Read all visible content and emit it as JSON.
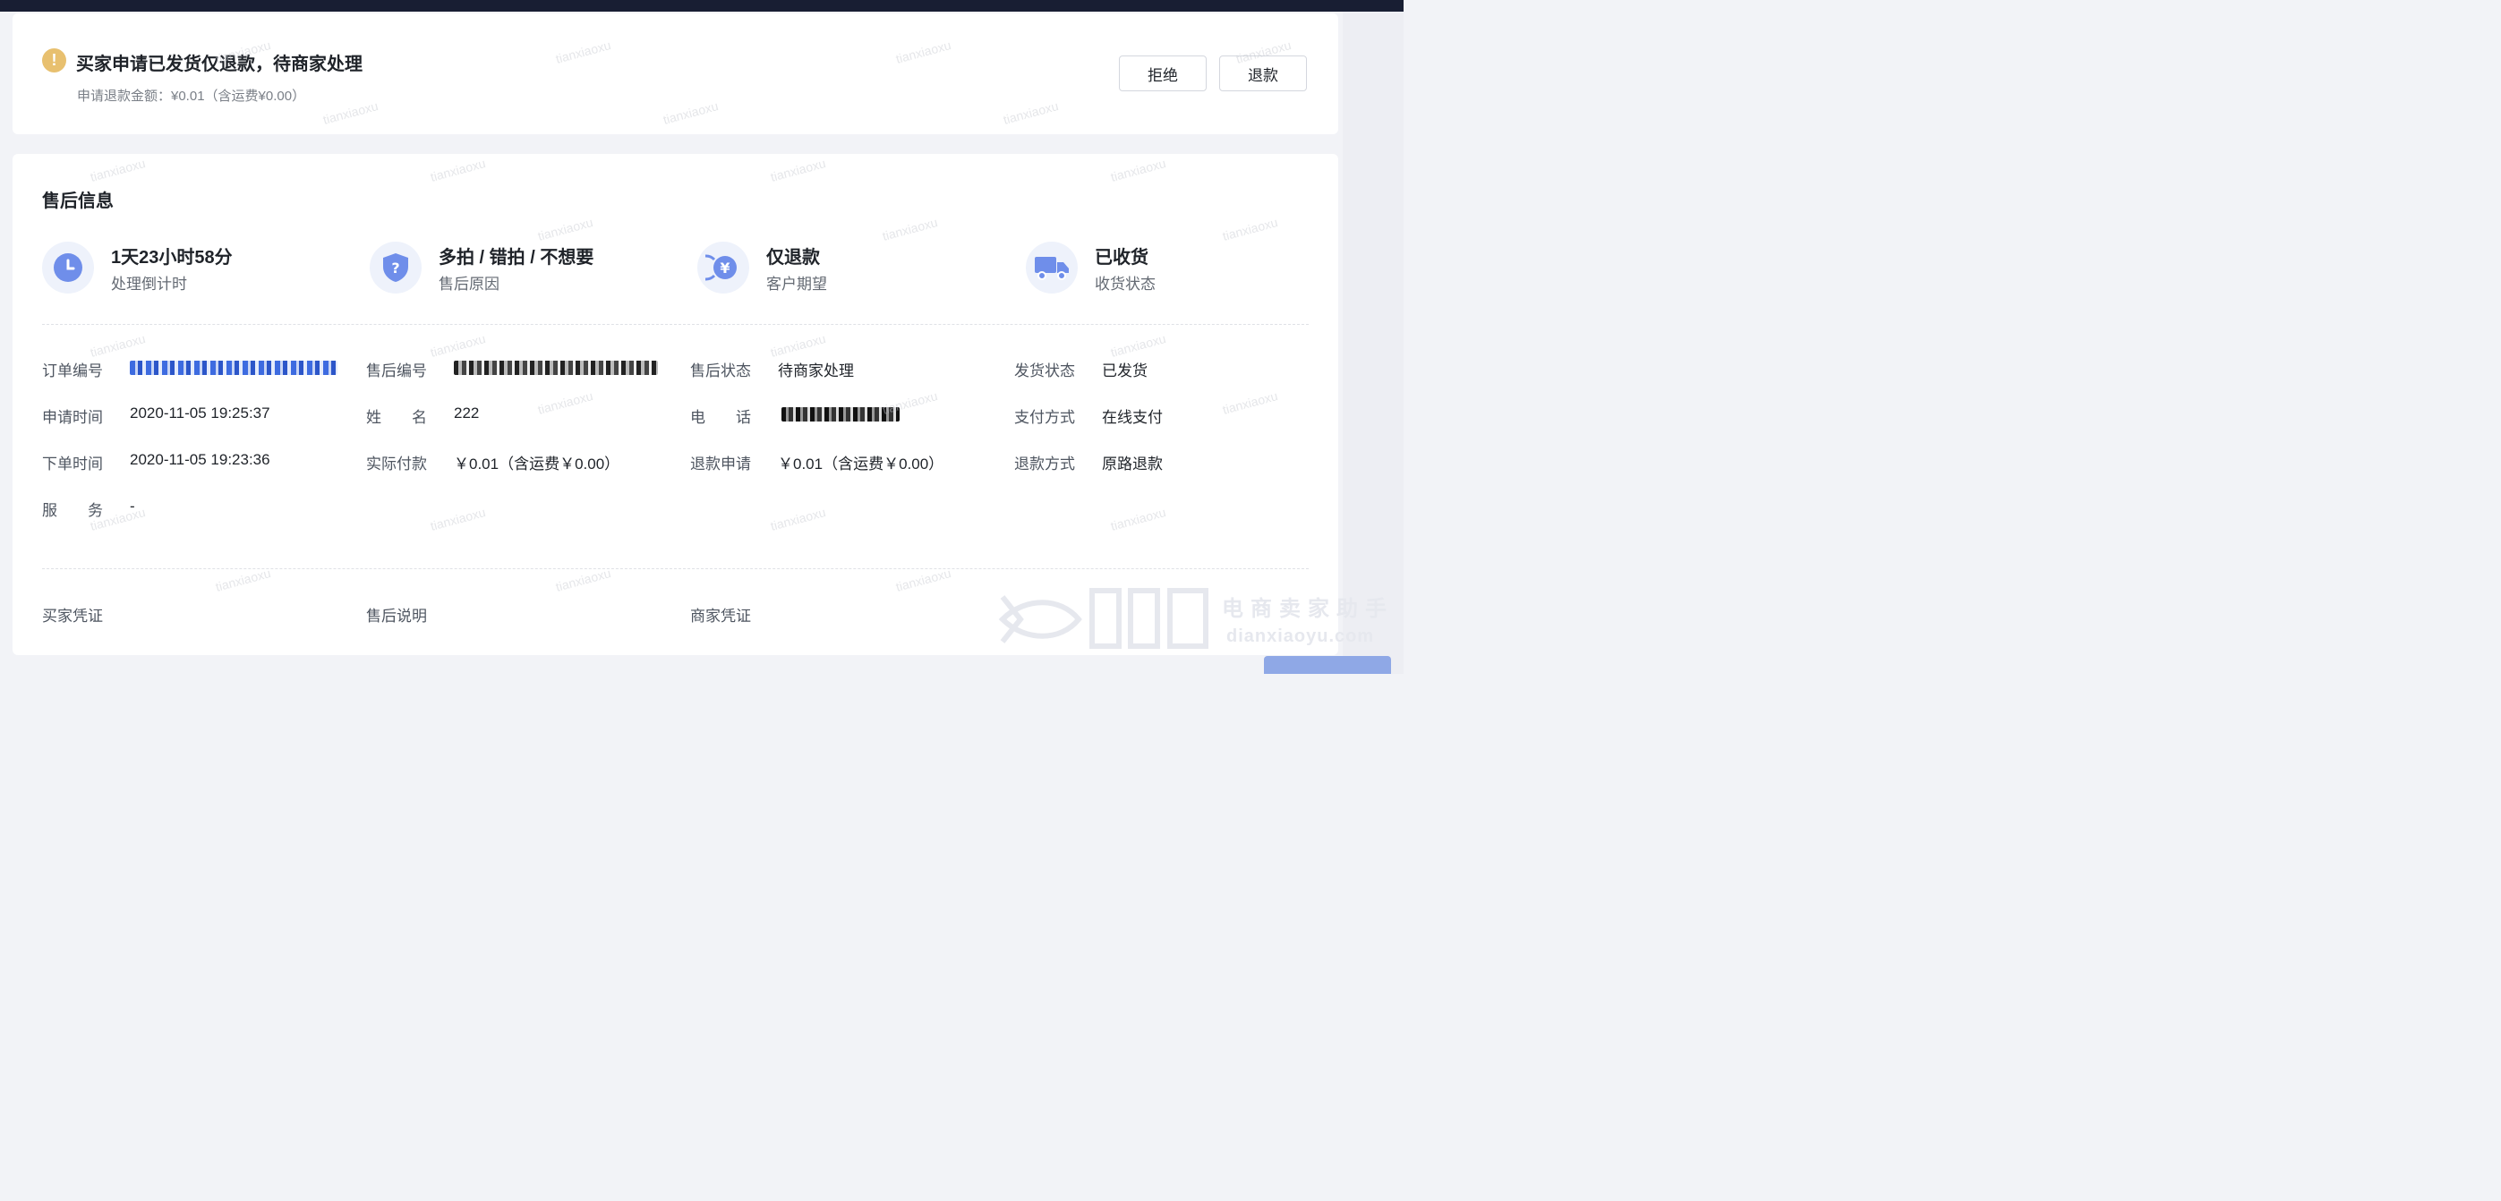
{
  "status": {
    "title": "买家申请已发货仅退款，待商家处理",
    "subtitle": "申请退款金额：¥0.01（含运费¥0.00）",
    "warn_glyph": "!",
    "reject_label": "拒绝",
    "refund_label": "退款"
  },
  "after_sale": {
    "title": "售后信息",
    "summary": [
      {
        "main": "1天23小时58分",
        "sub": "处理倒计时",
        "icon": "clock-icon"
      },
      {
        "main": "多拍 / 错拍 / 不想要",
        "sub": "售后原因",
        "icon": "shield-question-icon"
      },
      {
        "main": "仅退款",
        "sub": "客户期望",
        "icon": "yen-refund-icon"
      },
      {
        "main": "已收货",
        "sub": "收货状态",
        "icon": "truck-icon"
      }
    ],
    "fields": {
      "order_no_label": "订单编号",
      "after_sale_no_label": "售后编号",
      "after_sale_status_label": "售后状态",
      "after_sale_status_value": "待商家处理",
      "ship_status_label": "发货状态",
      "ship_status_value": "已发货",
      "apply_time_label": "申请时间",
      "apply_time_value": "2020-11-05 19:25:37",
      "name_label": "姓　　名",
      "name_value": "222",
      "phone_label": "电　　话",
      "pay_method_label": "支付方式",
      "pay_method_value": "在线支付",
      "order_time_label": "下单时间",
      "order_time_value": "2020-11-05 19:23:36",
      "paid_label": "实际付款",
      "paid_value": "￥0.01（含运费￥0.00）",
      "refund_apply_label": "退款申请",
      "refund_apply_value": "￥0.01（含运费￥0.00）",
      "refund_method_label": "退款方式",
      "refund_method_value": "原路退款",
      "service_label": "服　　务",
      "service_value": "-"
    },
    "proofs": {
      "buyer": "买家凭证",
      "note": "售后说明",
      "merchant": "商家凭证"
    }
  },
  "watermark_text": "tianxiaoxu",
  "brand": {
    "cn": "电商卖家助手",
    "en": "dianxiaoyu.com"
  },
  "colors": {
    "accent_blue": "#5b7fe6",
    "warn": "#e8c06f",
    "topbar": "#181e33"
  }
}
